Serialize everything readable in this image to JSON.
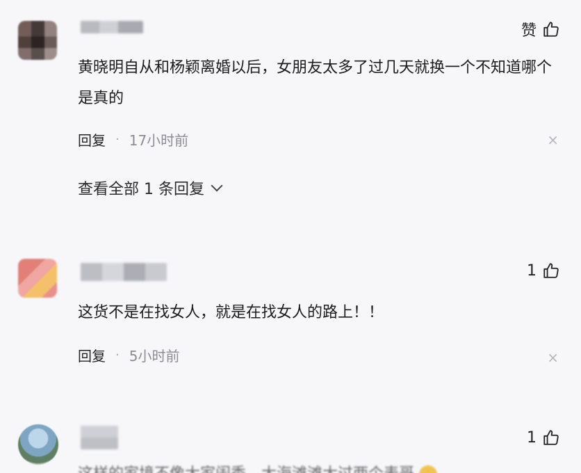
{
  "comments": [
    {
      "like_label": "赞",
      "text": "黄晓明自从和杨颖离婚以后，女朋友太多了过几天就换一个不知道哪个是真的",
      "reply_label": "回复",
      "separator": "·",
      "time": "17小时前",
      "close_glyph": "×",
      "view_replies": "查看全部 1 条回复"
    },
    {
      "like_label": "1",
      "text": "这货不是在找女人，就是在找女人的路上！！",
      "reply_label": "回复",
      "separator": "·",
      "time": "5小时前",
      "close_glyph": "×"
    },
    {
      "like_label": "1",
      "text": "这样的家境不像大家闺秀，大海滩滩大过两个表哥"
    }
  ],
  "icons": {
    "like": "thumbs-up-icon",
    "close": "close-icon",
    "expand": "chevron-down-icon"
  }
}
